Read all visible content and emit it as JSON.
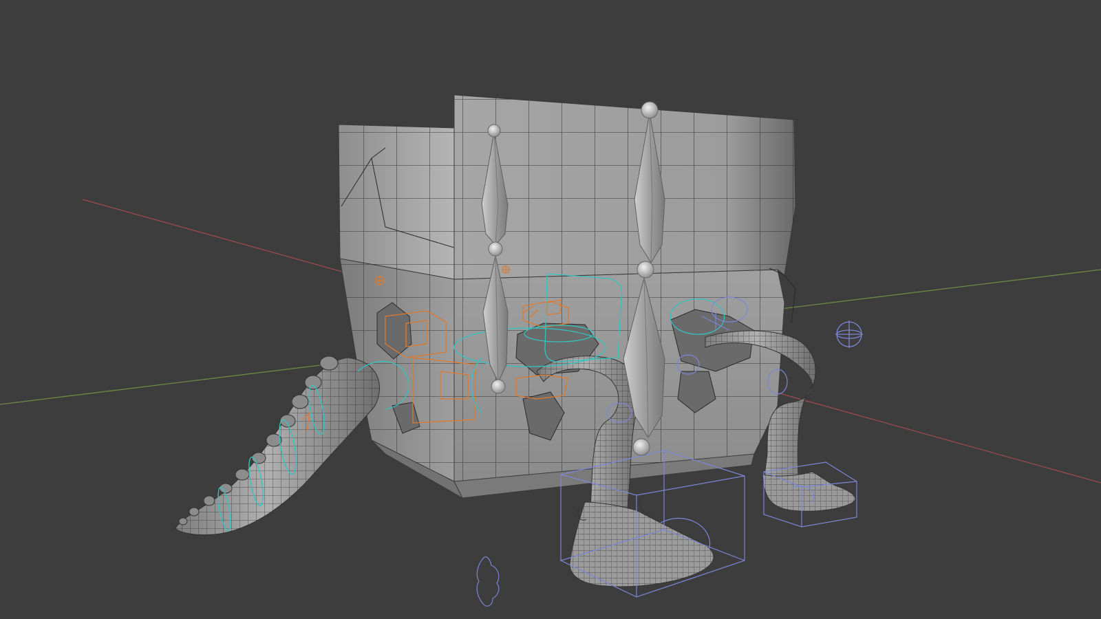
{
  "app": {
    "background": "#3d3d3d"
  },
  "viewport": {
    "axis_colors": {
      "x": "#9b4b52",
      "y": "#6f8a45"
    },
    "mesh_colors": {
      "surface_light": "#a9a9a9",
      "surface_mid": "#8f8f8f",
      "surface_dark": "#5f5f5f",
      "wire": "#2a2a2a"
    },
    "overlay_colors": {
      "bone": "#b9b9b9",
      "bone_outline": "#6a6a6a",
      "selected_controls": "#e07a2c",
      "spline_controls": "#35c3c1",
      "ik_controls": "#7c86d6"
    },
    "objects": [
      {
        "name": "character-body-mesh",
        "kind": "mesh"
      },
      {
        "name": "tail-mesh",
        "kind": "mesh"
      },
      {
        "name": "front-leg-mesh",
        "kind": "mesh"
      },
      {
        "name": "back-leg-mesh",
        "kind": "mesh"
      },
      {
        "name": "front-foot-mesh",
        "kind": "mesh"
      },
      {
        "name": "back-foot-mesh",
        "kind": "mesh"
      },
      {
        "name": "armature-bones",
        "kind": "bone"
      },
      {
        "name": "rig-controls",
        "kind": "control"
      },
      {
        "name": "light-empty",
        "kind": "empty"
      }
    ]
  }
}
